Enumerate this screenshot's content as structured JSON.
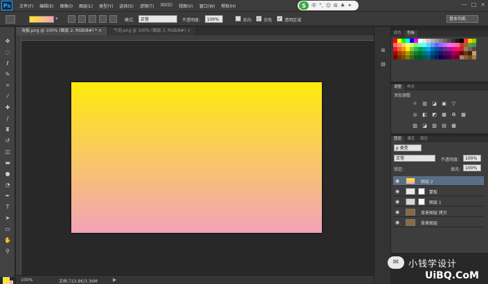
{
  "app": {
    "logo": "Ps"
  },
  "menu": [
    "文件(F)",
    "编辑(E)",
    "图像(I)",
    "图层(L)",
    "类型(Y)",
    "选择(S)",
    "滤镜(T)",
    "3D(D)",
    "视图(V)",
    "窗口(W)",
    "帮助(H)"
  ],
  "ime": {
    "logo": "S",
    "glyphs": [
      "中",
      "°,",
      "☺",
      "⊞",
      "♣",
      "✦"
    ]
  },
  "window_controls": [
    "—",
    "□",
    "×"
  ],
  "options": {
    "mode_label": "模式:",
    "mode_value": "正常",
    "opacity_label": "不透明度:",
    "opacity_value": "100%",
    "reverse_label": "反向",
    "dither_label": "仿色",
    "transparency_label": "透明区域",
    "dither_checked": "✓",
    "transparency_checked": "✓",
    "workspace": "基本功能"
  },
  "tabs": [
    {
      "label": "海报.png @ 100% (图层 2, RGB/8#) * ×",
      "active": true
    },
    {
      "label": "气泡.png @ 100% (图层 3, RGB/8#) ×",
      "active": false
    }
  ],
  "status": {
    "zoom": "100%",
    "doc": "文档:723.8K/3.36M",
    "arrow": "▶"
  },
  "swatches_panel": {
    "tabs": [
      "颜色",
      "色板"
    ],
    "active": 1
  },
  "swatch_colors": [
    "#ff0000",
    "#ffff00",
    "#00ff00",
    "#00ffff",
    "#0000ff",
    "#ff00ff",
    "#ffffff",
    "#e6e6e6",
    "#cccccc",
    "#b3b3b3",
    "#999999",
    "#808080",
    "#666666",
    "#4d4d4d",
    "#333333",
    "#1a1a1a",
    "#000000",
    "#ff3333",
    "#ffcc00",
    "#99cc00",
    "#ff6666",
    "#ff9966",
    "#ffcc66",
    "#ffff66",
    "#ccff66",
    "#66ff66",
    "#66ffcc",
    "#66ffff",
    "#66ccff",
    "#6699ff",
    "#6666ff",
    "#9966ff",
    "#cc66ff",
    "#ff66ff",
    "#ff66cc",
    "#ff6699",
    "#cc3333",
    "#996633",
    "#669933",
    "#339966",
    "#ee1c24",
    "#f26522",
    "#f7941d",
    "#fff200",
    "#8dc63f",
    "#39b54a",
    "#00a651",
    "#00a99d",
    "#00aeef",
    "#0072bc",
    "#0054a6",
    "#2e3192",
    "#662d91",
    "#92278f",
    "#ec008c",
    "#ed145b",
    "#c1272d",
    "#a67c52",
    "#736357",
    "#534741",
    "#9e0b0f",
    "#a0410d",
    "#a36209",
    "#aba000",
    "#598527",
    "#197b30",
    "#007236",
    "#00746b",
    "#0076a3",
    "#004a80",
    "#003471",
    "#1b1464",
    "#440e62",
    "#630460",
    "#9e005d",
    "#9e0039",
    "#790000",
    "#603913",
    "#42210b",
    "#c69c6d",
    "#790000",
    "#7b2e00",
    "#7d4900",
    "#827b00",
    "#406618",
    "#005e20",
    "#005826",
    "#005952",
    "#005b7f",
    "#003663",
    "#002157",
    "#0d004c",
    "#32004b",
    "#4b0049",
    "#7b0046",
    "#7a0026",
    "#998675",
    "#8c6239",
    "#754c24",
    "#a67c52"
  ],
  "adjustments": {
    "tabs": [
      "调整",
      "样式"
    ],
    "active": 0,
    "label": "添加调整",
    "icons": [
      "☼",
      "▥",
      "◪",
      "▣",
      "▽",
      "◎",
      "◧",
      "◩",
      "▦",
      "♻",
      "▦",
      "▨",
      "◪",
      "▧",
      "▤",
      "▦"
    ]
  },
  "layers_panel": {
    "tabs": [
      "图层",
      "通道",
      "路径"
    ],
    "active": 0,
    "filter_label": "ρ 类型",
    "blend_mode": "正常",
    "opacity_label": "不透明度:",
    "opacity_value": "100%",
    "lock_label": "锁定:",
    "fill_label": "填充:",
    "fill_value": "100%"
  },
  "layers": [
    {
      "name": "图层 2",
      "selected": true,
      "thumb": "linear-gradient(#ffe82a,#f3a2bf)"
    },
    {
      "name": "蒙板",
      "selected": false,
      "thumb": "#eeeeee"
    },
    {
      "name": "图层 1",
      "selected": false,
      "thumb": "#dddddd"
    },
    {
      "name": "背景图层 拷贝",
      "selected": false,
      "thumb": "#8a6a3e"
    },
    {
      "name": "背景图层",
      "selected": false,
      "thumb": "#8a6a3e"
    }
  ],
  "watermark": {
    "text1": "小钱学设计",
    "text2": "UiBQ.CoM"
  }
}
